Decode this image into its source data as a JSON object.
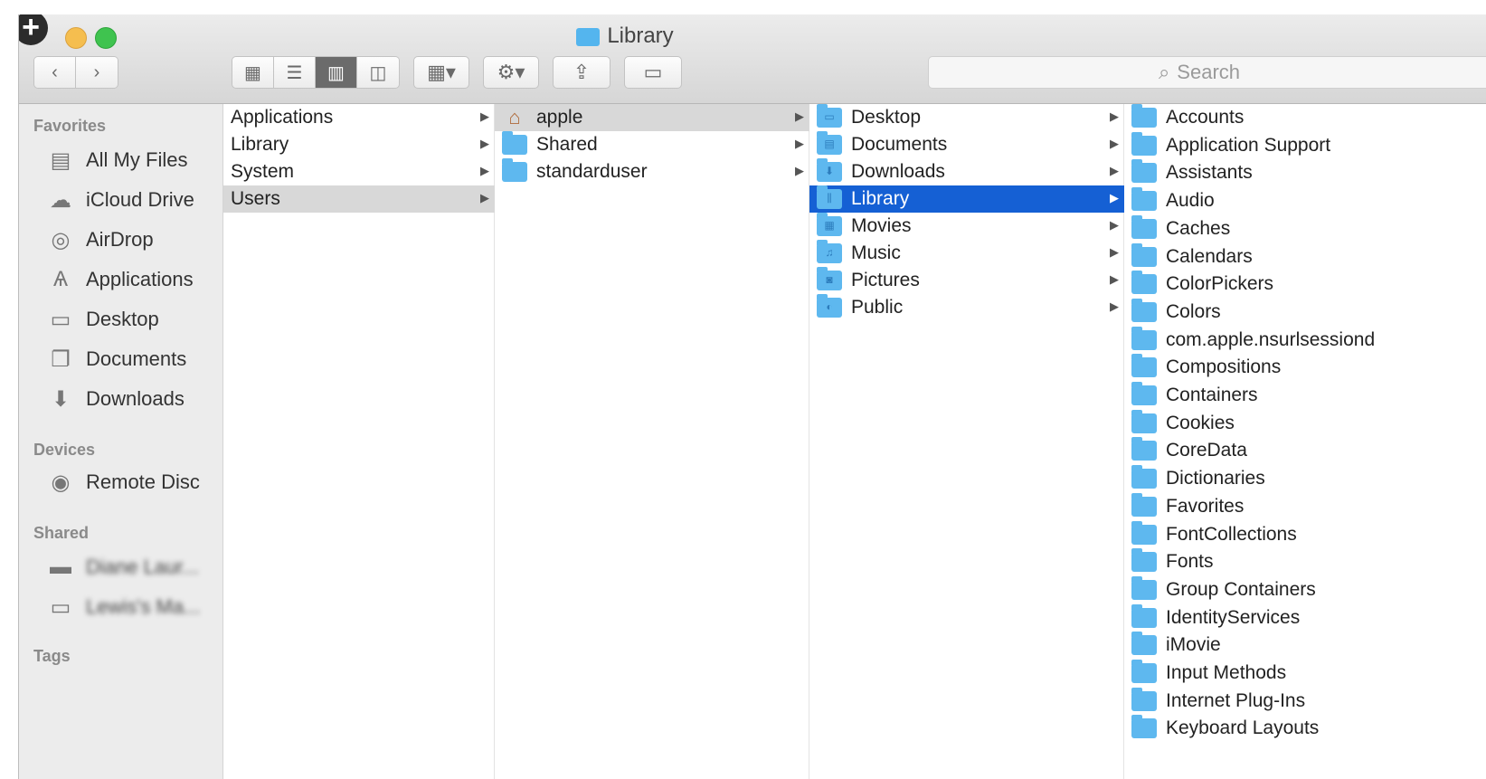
{
  "window": {
    "title": "Library"
  },
  "toolbar": {
    "back": "‹",
    "forward": "›",
    "views": [
      "grid-view-icon",
      "list-view-icon",
      "column-view-icon",
      "coverflow-view-icon"
    ],
    "search_placeholder": "Search"
  },
  "sidebar": {
    "favorites_label": "Favorites",
    "favorites": [
      {
        "label": "All My Files",
        "icon": "files-icon"
      },
      {
        "label": "iCloud Drive",
        "icon": "cloud-icon"
      },
      {
        "label": "AirDrop",
        "icon": "airdrop-icon"
      },
      {
        "label": "Applications",
        "icon": "applications-icon"
      },
      {
        "label": "Desktop",
        "icon": "desktop-icon"
      },
      {
        "label": "Documents",
        "icon": "documents-icon"
      },
      {
        "label": "Downloads",
        "icon": "downloads-icon"
      }
    ],
    "devices_label": "Devices",
    "devices": [
      {
        "label": "Remote Disc",
        "icon": "disc-icon"
      }
    ],
    "shared_label": "Shared",
    "shared": [
      {
        "label": "Diane Laur...",
        "icon": "server-icon"
      },
      {
        "label": "Lewis's Ma...",
        "icon": "computer-icon"
      }
    ],
    "tags_label": "Tags"
  },
  "columns": {
    "col1": [
      "Applications",
      "Library",
      "System",
      "Users"
    ],
    "col2": [
      "apple",
      "Shared",
      "standarduser"
    ],
    "col3": [
      "Desktop",
      "Documents",
      "Downloads",
      "Library",
      "Movies",
      "Music",
      "Pictures",
      "Public"
    ],
    "col4": [
      "Accounts",
      "Application Support",
      "Assistants",
      "Audio",
      "Caches",
      "Calendars",
      "ColorPickers",
      "Colors",
      "com.apple.nsurlsessiond",
      "Compositions",
      "Containers",
      "Cookies",
      "CoreData",
      "Dictionaries",
      "Favorites",
      "FontCollections",
      "Fonts",
      "Group Containers",
      "IdentityServices",
      "iMovie",
      "Input Methods",
      "Internet Plug-Ins",
      "Keyboard Layouts"
    ]
  },
  "colors": {
    "selection_blue": "#1560d4",
    "folder_blue": "#5eb8ef"
  }
}
